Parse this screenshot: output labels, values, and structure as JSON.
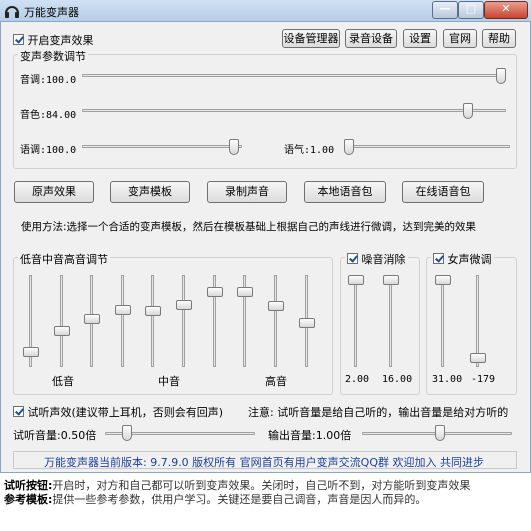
{
  "window": {
    "title": "万能变声器",
    "controls": {
      "minimize": "—",
      "maximize": "□",
      "close": "✕"
    }
  },
  "top": {
    "enable_effect": "开启变声效果",
    "buttons": [
      "设备管理器",
      "录音设备",
      "设置",
      "官网",
      "帮助"
    ]
  },
  "params": {
    "group_label": "变声参数调节",
    "pitch_label": "音调:100.0",
    "timbre_label": "音色:84.00",
    "speed_label": "语调:100.0",
    "tone_label": "语气:1.00"
  },
  "sliders": {
    "pitch": 1.0,
    "timbre": 0.92,
    "speed": 0.98,
    "tone": 0.0
  },
  "actions": [
    "原声效果",
    "变声模板",
    "录制声音",
    "本地语音包",
    "在线语音包"
  ],
  "usage": "使用方法:选择一个合适的变声模板，然后在模板基础上根据自己的声线进行微调，达到完美的效果",
  "eq": {
    "group_label": "低音中音高音调节",
    "low_label": "低音",
    "mid_label": "中音",
    "high_label": "高音",
    "levels": [
      0.12,
      0.38,
      0.52,
      0.63,
      0.62,
      0.7,
      0.85,
      0.85,
      0.68,
      0.48
    ]
  },
  "noise": {
    "label": "噪音消除",
    "values": [
      "2.00",
      "16.00"
    ],
    "levels": [
      1.0,
      1.0
    ]
  },
  "female": {
    "label": "女声微调",
    "values": [
      "31.00",
      "-179"
    ],
    "levels": [
      1.0,
      0.05
    ]
  },
  "monitor": {
    "label": "试听声效(建议带上耳机，否则会有回声)",
    "note": "注意: 试听音量是给自己听的，输出音量是给对方听的",
    "listen_label": "试听音量:0.50倍",
    "output_label": "输出音量:1.00倍",
    "listen_level": 0.12,
    "output_level": 0.52
  },
  "status": "万能变声器当前版本: 9.7.9.0  版权所有  官网首页有用户变声交流QQ群 欢迎加入 共同进步",
  "footer": {
    "line1_key": "试听按钮:",
    "line1_text": "开启时，对方和自己都可以听到变声效果。关闭时，自己听不到，对方能听到变声效果",
    "line2_key": "参考模板:",
    "line2_text": "提供一些参考参数，供用户学习。关键还是要自己调音，声音是因人而异的。"
  }
}
